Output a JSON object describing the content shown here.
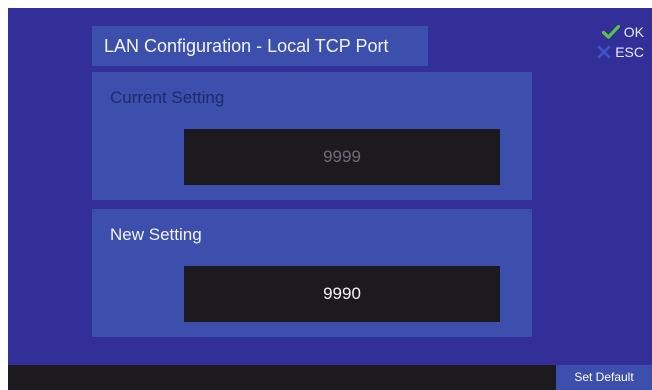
{
  "title": "LAN Configuration - Local TCP Port",
  "actions": {
    "ok_label": "OK",
    "esc_label": "ESC",
    "set_default_label": "Set Default"
  },
  "current_setting": {
    "label": "Current Setting",
    "value": "9999"
  },
  "new_setting": {
    "label": "New Setting",
    "value": "9990"
  },
  "icons": {
    "ok": "checkmark-icon",
    "esc": "x-icon"
  },
  "colors": {
    "background": "#322f99",
    "panel": "#3c4fad",
    "value_box": "#1d1a1f",
    "ok_check": "#5cc443",
    "esc_x": "#3a55c9"
  }
}
